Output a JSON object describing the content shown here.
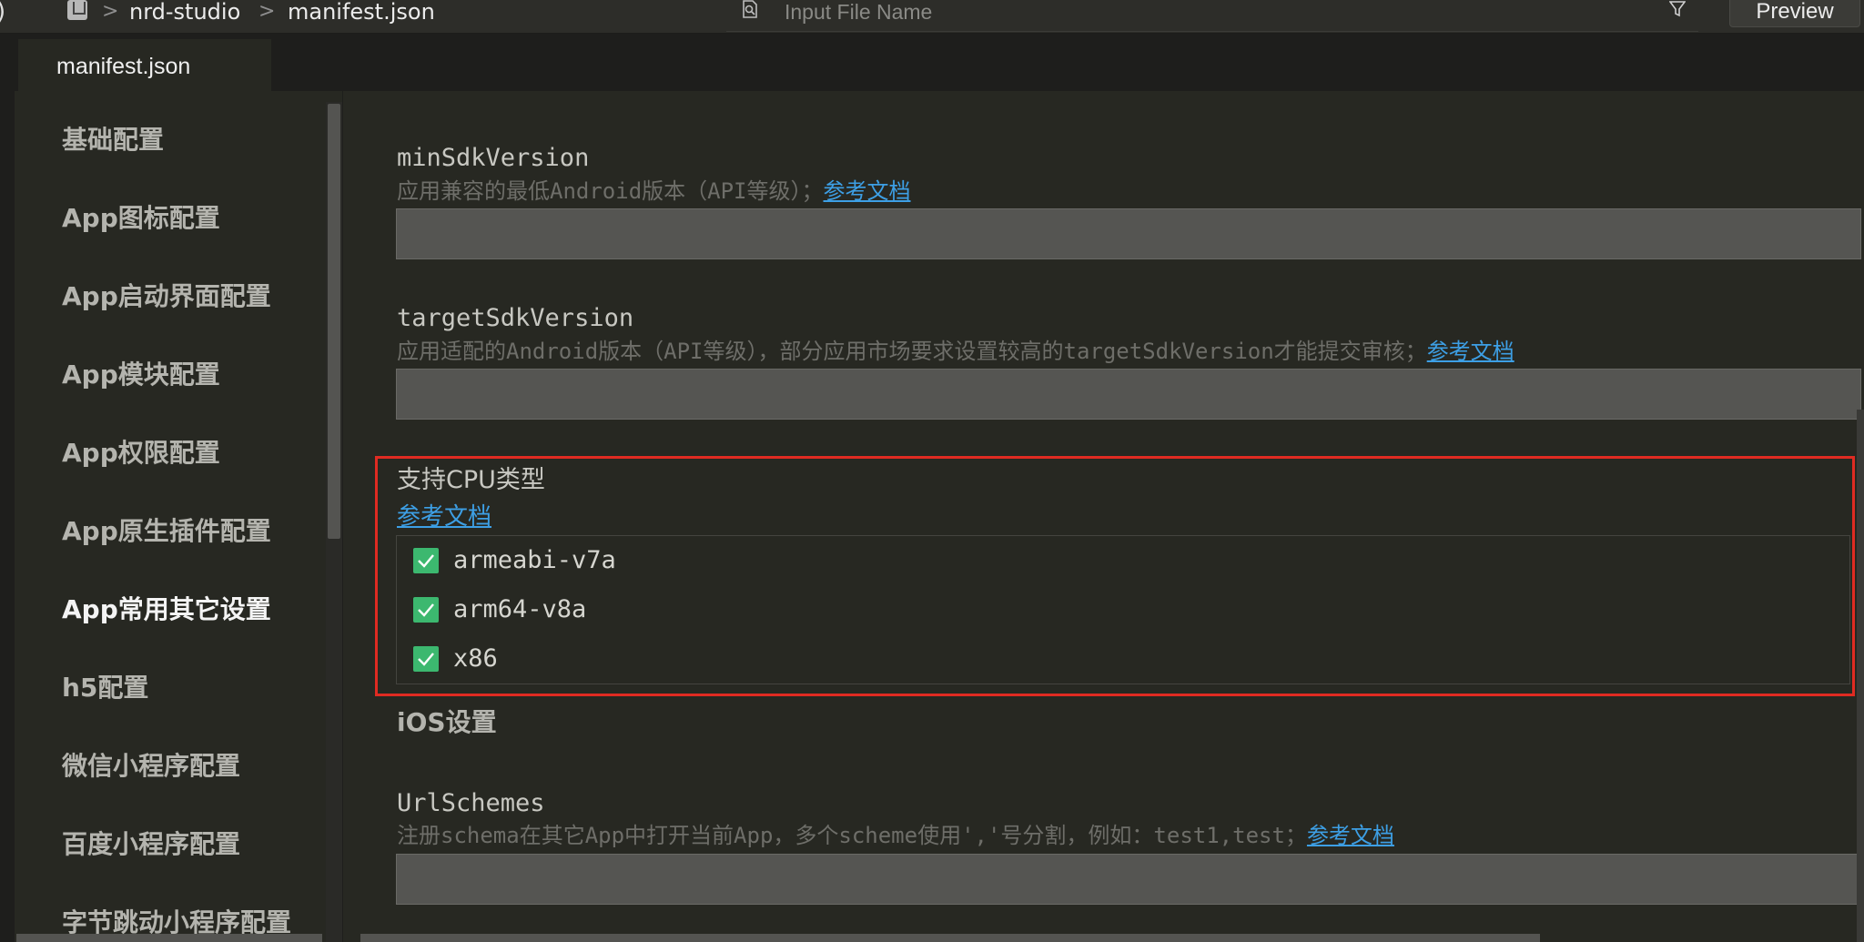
{
  "breadcrumb": {
    "project": "nrd-studio",
    "file": "manifest.json"
  },
  "search": {
    "placeholder": "Input File Name"
  },
  "toolbar": {
    "preview_label": "Preview"
  },
  "tab": {
    "label": "manifest.json"
  },
  "sidebar": {
    "items": [
      {
        "label": "基础配置"
      },
      {
        "label": "App图标配置"
      },
      {
        "label": "App启动界面配置"
      },
      {
        "label": "App模块配置"
      },
      {
        "label": "App权限配置"
      },
      {
        "label": "App原生插件配置"
      },
      {
        "label": "App常用其它设置"
      },
      {
        "label": "h5配置"
      },
      {
        "label": "微信小程序配置"
      },
      {
        "label": "百度小程序配置"
      },
      {
        "label": "字节跳动小程序配置"
      }
    ],
    "active_index": 6
  },
  "fields": {
    "min_sdk": {
      "title": "minSdkVersion",
      "desc": "应用兼容的最低Android版本（API等级）；",
      "link": "参考文档",
      "value": ""
    },
    "target_sdk": {
      "title": "targetSdkVersion",
      "desc": "应用适配的Android版本（API等级），部分应用市场要求设置较高的targetSdkVersion才能提交审核；",
      "link": "参考文档",
      "value": ""
    },
    "cpu": {
      "title": "支持CPU类型",
      "link": "参考文档",
      "options": [
        {
          "label": "armeabi-v7a",
          "checked": true
        },
        {
          "label": "arm64-v8a",
          "checked": true
        },
        {
          "label": "x86",
          "checked": true
        }
      ]
    },
    "ios_section": "iOS设置",
    "url_schemes": {
      "title": "UrlSchemes",
      "desc": "注册schema在其它App中打开当前App，多个scheme使用','号分割，例如：test1,test；",
      "link": "参考文档",
      "value": ""
    }
  },
  "colors": {
    "background": "#272822",
    "link": "#3d9fe5",
    "checkbox": "#3cb86f",
    "highlight": "#e02b22"
  }
}
